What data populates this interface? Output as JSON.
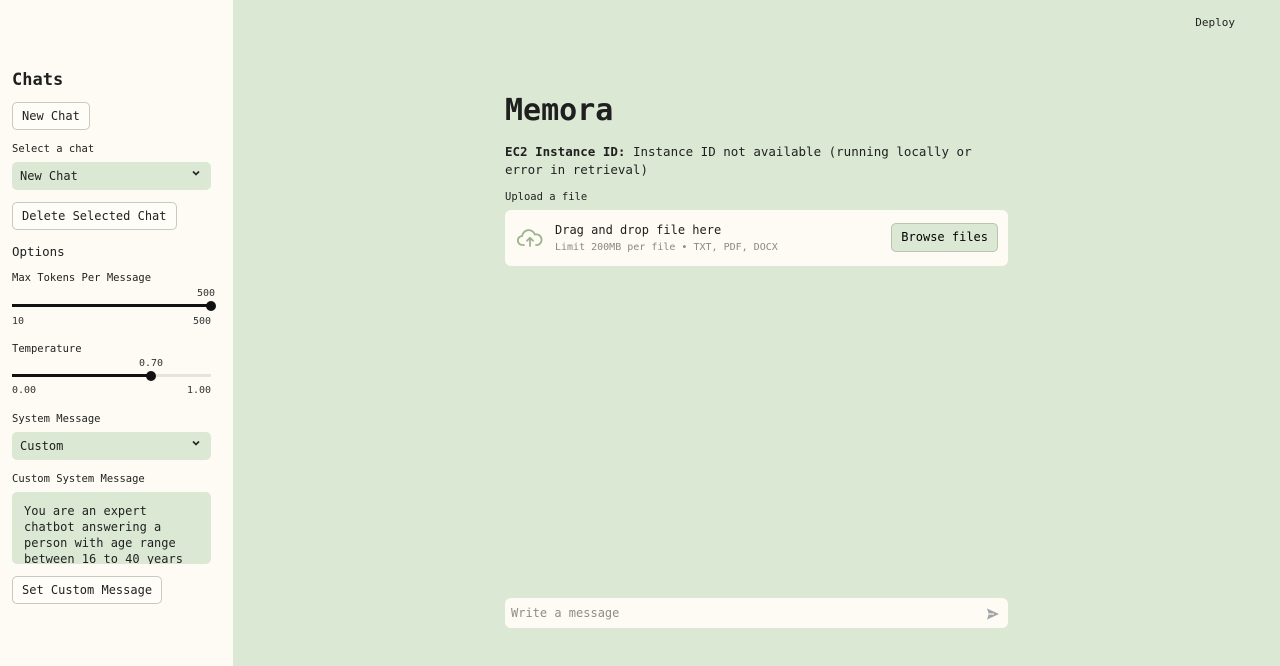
{
  "header": {
    "deploy_label": "Deploy"
  },
  "sidebar": {
    "title": "Chats",
    "new_chat_label": "New Chat",
    "select_chat_label": "Select a chat",
    "select_chat_value": "New Chat",
    "delete_label": "Delete Selected Chat",
    "options_label": "Options",
    "max_tokens": {
      "label": "Max Tokens Per Message",
      "value": "500",
      "min": "10",
      "max": "500",
      "fraction": 1.0
    },
    "temperature": {
      "label": "Temperature",
      "value": "0.70",
      "min": "0.00",
      "max": "1.00",
      "fraction": 0.7
    },
    "system_message_label": "System Message",
    "system_message_value": "Custom",
    "custom_system_label": "Custom System Message",
    "custom_system_text": "You are an expert chatbot answering a person with age range between 16 to 40 years",
    "set_custom_label": "Set Custom Message"
  },
  "main": {
    "title": "Memora",
    "ec2_label": "EC2 Instance ID:",
    "ec2_value": " Instance ID not available (running locally or error in retrieval)",
    "upload_label": "Upload a file",
    "dropzone_title": "Drag and drop file here",
    "dropzone_limits": "Limit 200MB per file • TXT, PDF, DOCX",
    "browse_label": "Browse files",
    "chat_placeholder": "Write a message"
  },
  "colors": {
    "accent_green": "#dbe9d4",
    "sidebar_bg": "#fdfbf3",
    "slider_track": "#111111"
  },
  "icons": {
    "upload": "cloud-upload-icon",
    "send": "send-icon",
    "chevron": "chevron-down-icon"
  }
}
